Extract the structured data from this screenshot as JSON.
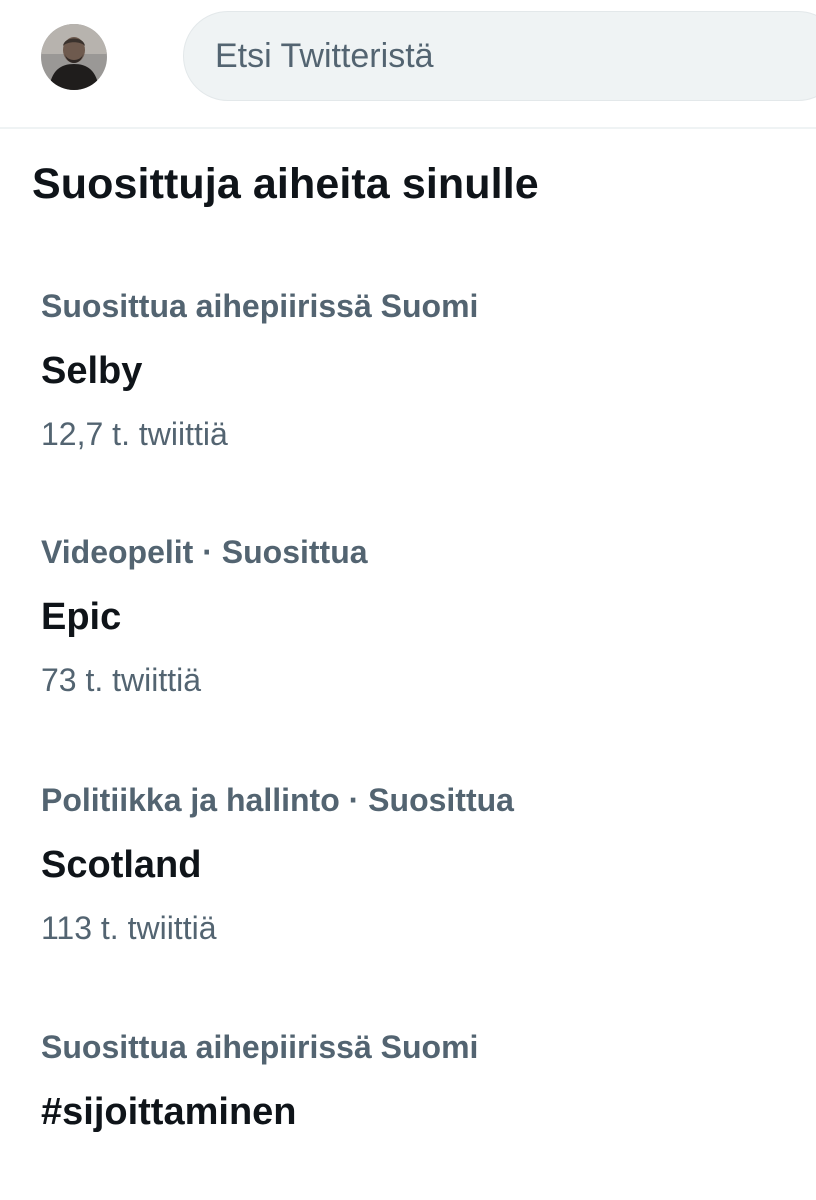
{
  "header": {
    "search_placeholder": "Etsi Twitteristä"
  },
  "section": {
    "title": "Suosittuja aiheita sinulle"
  },
  "trends": [
    {
      "context": "Suosittua aihepiirissä Suomi",
      "name": "Selby",
      "count": "12,7 t. twiittiä"
    },
    {
      "context": "Videopelit · Suosittua",
      "name": "Epic",
      "count": "73 t. twiittiä"
    },
    {
      "context": "Politiikka ja hallinto · Suosittua",
      "name": "Scotland",
      "count": "113 t. twiittiä"
    },
    {
      "context": "Suosittua aihepiirissä Suomi",
      "name": "#sijoittaminen"
    }
  ],
  "colors": {
    "primary_text": "#0f1419",
    "secondary_text": "#536471",
    "search_bg": "#eff3f4",
    "divider": "#eff3f4"
  }
}
